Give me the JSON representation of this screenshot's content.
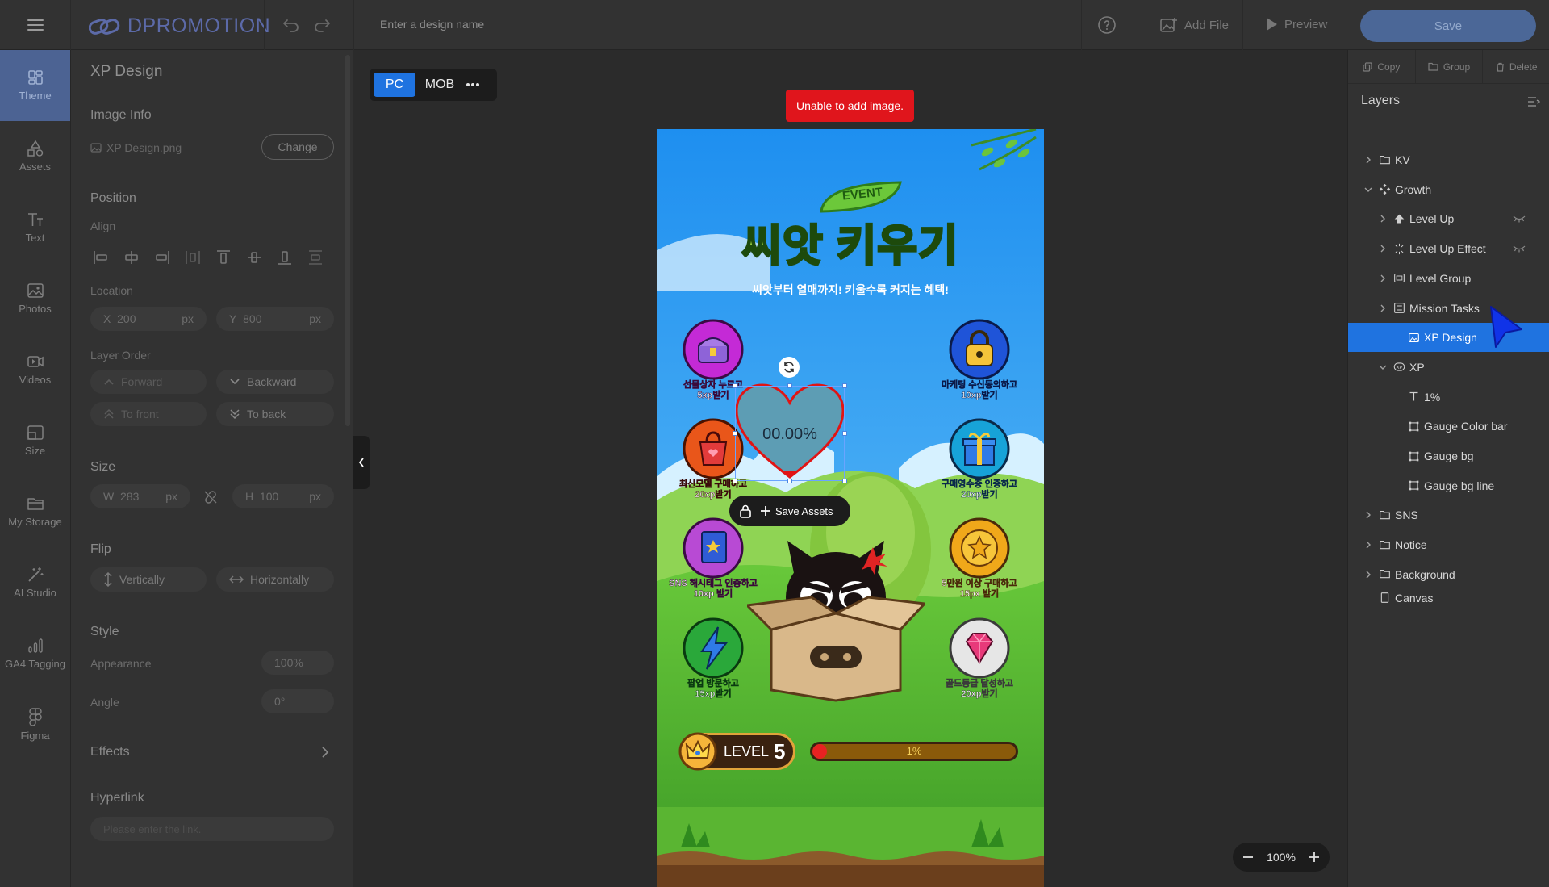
{
  "topbar": {
    "logo_text": "DPROMOTION",
    "design_name_placeholder": "Enter a design name",
    "add_file_label": "Add File",
    "preview_label": "Preview",
    "save_label": "Save"
  },
  "nav": {
    "items": [
      {
        "label": "Theme",
        "icon": "theme-icon"
      },
      {
        "label": "Assets",
        "icon": "assets-icon"
      },
      {
        "label": "Text",
        "icon": "text-icon"
      },
      {
        "label": "Photos",
        "icon": "photos-icon"
      },
      {
        "label": "Videos",
        "icon": "videos-icon"
      },
      {
        "label": "Size",
        "icon": "size-icon"
      },
      {
        "label": "My Storage",
        "icon": "folder-icon"
      },
      {
        "label": "AI Studio",
        "icon": "magic-wand-icon"
      },
      {
        "label": "GA4 Tagging",
        "icon": "analytics-icon"
      },
      {
        "label": "Figma",
        "icon": "figma-icon"
      }
    ]
  },
  "props": {
    "title": "XP Design",
    "image_info_heading": "Image Info",
    "file_name": "XP Design.png",
    "change_label": "Change",
    "position_heading": "Position",
    "align_label": "Align",
    "location_label": "Location",
    "x_label": "X",
    "x_value": "200",
    "y_label": "Y",
    "y_value": "800",
    "unit": "px",
    "layer_order_label": "Layer Order",
    "forward_label": "Forward",
    "backward_label": "Backward",
    "to_front_label": "To front",
    "to_back_label": "To back",
    "size_heading": "Size",
    "w_label": "W",
    "w_value": "283",
    "h_label": "H",
    "h_value": "100",
    "flip_heading": "Flip",
    "vertically_label": "Vertically",
    "horizontally_label": "Horizontally",
    "style_heading": "Style",
    "appearance_label": "Appearance",
    "appearance_value": "100%",
    "angle_label": "Angle",
    "angle_value": "0°",
    "effects_label": "Effects",
    "hyperlink_heading": "Hyperlink",
    "hyperlink_placeholder": "Please enter the link."
  },
  "canvas": {
    "pc_label": "PC",
    "mob_label": "MOB",
    "error_message": "Unable to add image.",
    "zoom_value": "100%",
    "save_assets_label": "Save Assets",
    "artboard": {
      "event_badge": "EVENT",
      "title": "씨앗 키우기",
      "subtitle": "씨앗부터 열매까지! 키울수록 커지는 혜택!",
      "heart_percent": "00.00%",
      "missions": [
        {
          "line1": "선물상자 누르고",
          "line2": "5xp받기",
          "color": "#c42ad6",
          "icon": "treasure-chest-icon"
        },
        {
          "line1": "마케팅 수신동의하고",
          "line2": "10xp받기",
          "color": "#1f54d8",
          "icon": "padlock-icon"
        },
        {
          "line1": "최신모델 구매하고",
          "line2": "20xp받기",
          "color": "#e9561a",
          "icon": "shopping-bag-icon"
        },
        {
          "line1": "구매영수증 인증하고",
          "line2": "20xp받기",
          "color": "#17a3d8",
          "icon": "gift-icon"
        },
        {
          "line1": "SNS 해시태그 인증하고",
          "line2": "10xp 받기",
          "color": "#b84ad4",
          "icon": "book-icon"
        },
        {
          "line1": "5만원 이상 구매하고",
          "line2": "15px 받기",
          "color": "#f0a81a",
          "icon": "star-coin-icon"
        },
        {
          "line1": "팝업 방문하고",
          "line2": "15xp받기",
          "color": "#2aa83a",
          "icon": "lightning-icon"
        },
        {
          "line1": "골드등급 달성하고",
          "line2": "20xp받기",
          "color": "#d8d8d8",
          "icon": "gem-icon"
        }
      ],
      "level_label": "LEVEL",
      "level_number": "5",
      "gauge_text": "1%",
      "gauge_progress": 0.01
    }
  },
  "layers": {
    "copy_label": "Copy",
    "group_label": "Group",
    "delete_label": "Delete",
    "heading": "Layers",
    "items": [
      {
        "label": "KV",
        "depth": 0,
        "chevron": "right",
        "icon": "folder-icon"
      },
      {
        "label": "Growth",
        "depth": 0,
        "chevron": "down",
        "icon": "components-icon"
      },
      {
        "label": "Level Up",
        "depth": 1,
        "chevron": "right",
        "icon": "arrow-up-icon",
        "hidden": true
      },
      {
        "label": "Level Up Effect",
        "depth": 1,
        "chevron": "right",
        "icon": "sparkle-icon",
        "hidden": true
      },
      {
        "label": "Level Group",
        "depth": 1,
        "chevron": "right",
        "icon": "frame-icon"
      },
      {
        "label": "Mission Tasks",
        "depth": 1,
        "chevron": "right",
        "icon": "list-icon"
      },
      {
        "label": "XP Design",
        "depth": 2,
        "chevron": "",
        "icon": "image-icon",
        "selected": true
      },
      {
        "label": "XP",
        "depth": 1,
        "chevron": "down",
        "icon": "xp-badge-icon"
      },
      {
        "label": "1%",
        "depth": 2,
        "chevron": "",
        "icon": "text-icon"
      },
      {
        "label": "Gauge Color bar",
        "depth": 2,
        "chevron": "",
        "icon": "shape-icon"
      },
      {
        "label": "Gauge bg",
        "depth": 2,
        "chevron": "",
        "icon": "shape-icon"
      },
      {
        "label": "Gauge bg line",
        "depth": 2,
        "chevron": "",
        "icon": "shape-icon"
      },
      {
        "label": "SNS",
        "depth": 0,
        "chevron": "right",
        "icon": "folder-icon"
      },
      {
        "label": "Notice",
        "depth": 0,
        "chevron": "right",
        "icon": "folder-icon"
      },
      {
        "label": "Background",
        "depth": 0,
        "chevron": "right",
        "icon": "folder-icon"
      },
      {
        "label": "Canvas",
        "depth": 0,
        "chevron": "",
        "icon": "canvas-icon"
      }
    ]
  },
  "colors": {
    "accent": "#1f73e0",
    "save_button": "#4b6797",
    "error": "#e0151c"
  }
}
